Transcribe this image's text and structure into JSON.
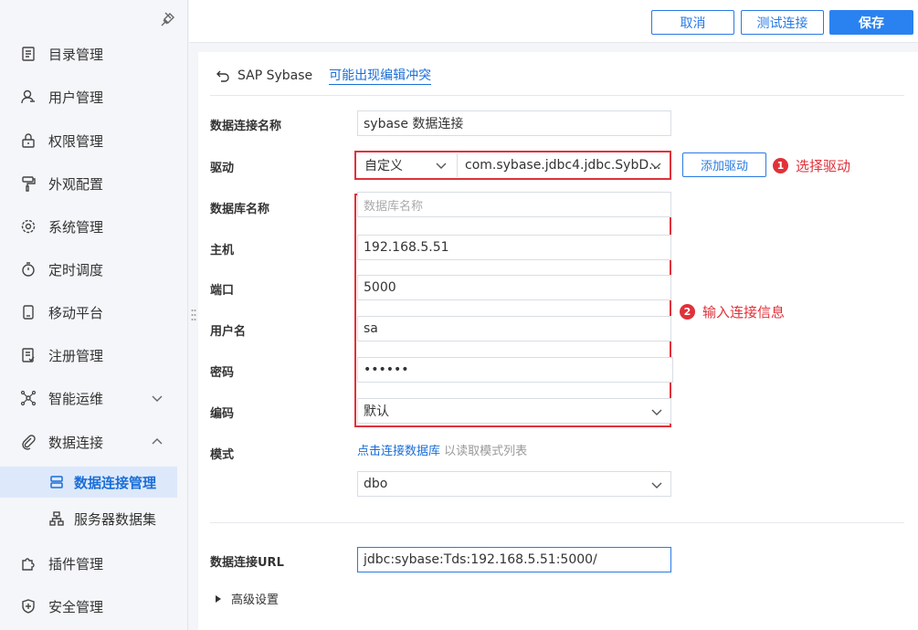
{
  "sidebar": {
    "items": [
      {
        "label": "目录管理",
        "icon": "catalog-icon"
      },
      {
        "label": "用户管理",
        "icon": "user-icon"
      },
      {
        "label": "权限管理",
        "icon": "lock-icon"
      },
      {
        "label": "外观配置",
        "icon": "paint-roller-icon"
      },
      {
        "label": "系统管理",
        "icon": "gear-icon"
      },
      {
        "label": "定时调度",
        "icon": "timer-icon"
      },
      {
        "label": "移动平台",
        "icon": "mobile-icon"
      },
      {
        "label": "注册管理",
        "icon": "register-icon"
      },
      {
        "label": "智能运维",
        "icon": "network-icon"
      },
      {
        "label": "数据连接",
        "icon": "paperclip-icon"
      },
      {
        "label": "插件管理",
        "icon": "puzzle-icon"
      },
      {
        "label": "安全管理",
        "icon": "shield-icon"
      }
    ],
    "subitems": [
      {
        "label": "数据连接管理",
        "icon": "database-icon",
        "active": true
      },
      {
        "label": "服务器数据集",
        "icon": "server-dataset-icon",
        "active": false
      }
    ]
  },
  "toolbar": {
    "cancel_label": "取消",
    "test_label": "测试连接",
    "save_label": "保存"
  },
  "header": {
    "title": "SAP Sybase",
    "conflict_link": "可能出现编辑冲突"
  },
  "form": {
    "name_label": "数据连接名称",
    "name_value": "sybase 数据连接",
    "driver_label": "驱动",
    "driver_type": "自定义",
    "driver_class": "com.sybase.jdbc4.jdbc.SybD...",
    "add_driver_label": "添加驱动",
    "db_label": "数据库名称",
    "db_placeholder": "数据库名称",
    "host_label": "主机",
    "host_value": "192.168.5.51",
    "port_label": "端口",
    "port_value": "5000",
    "user_label": "用户名",
    "user_value": "sa",
    "password_label": "密码",
    "password_value": "••••••",
    "encoding_label": "编码",
    "encoding_value": "默认",
    "schema_label": "模式",
    "schema_link": "点击连接数据库",
    "schema_hint": "以读取模式列表",
    "schema_value": "dbo",
    "url_label": "数据连接URL",
    "url_value": "jdbc:sybase:Tds:192.168.5.51:5000/",
    "advanced_label": "高级设置"
  },
  "annotations": {
    "note1_num": "1",
    "note1_text": "选择驱动",
    "note2_num": "2",
    "note2_text": "输入连接信息"
  },
  "colors": {
    "accent": "#2a82f0",
    "annotation": "#e0313a"
  }
}
